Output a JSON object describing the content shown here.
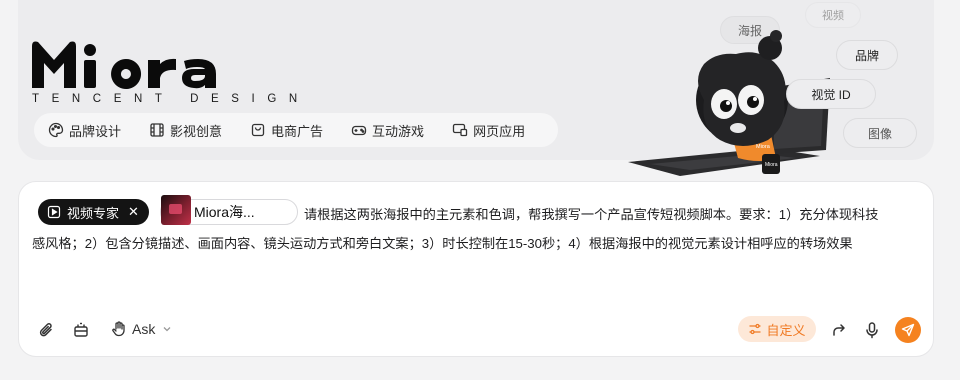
{
  "brand": {
    "name": "Miora",
    "subtitle": "TENCENT DESIGN"
  },
  "categories": [
    {
      "label": "品牌设计",
      "icon": "palette-icon"
    },
    {
      "label": "影视创意",
      "icon": "film-icon"
    },
    {
      "label": "电商广告",
      "icon": "shopping-bag-icon"
    },
    {
      "label": "互动游戏",
      "icon": "gamepad-icon"
    },
    {
      "label": "网页应用",
      "icon": "browser-window-icon"
    }
  ],
  "floating_tags": {
    "poster": "海报",
    "video": "视频",
    "brand": "品牌",
    "visual_id": "视觉 ID",
    "image": "图像"
  },
  "mascot": {
    "label": "Miora"
  },
  "composer": {
    "expert_tag": "视频专家",
    "expert_close": "✕",
    "attachment_name": "Miora海...",
    "prompt_line1": "请根据这两张海报中的主元素和色调，帮我撰写一个产品宣传短视频脚本。要求：1）充分体现科技",
    "prompt_line2": "感风格；2）包含分镜描述、画面内容、镜头运动方式和旁白文案；3）时长控制在15-30秒；4）根据海报中的视觉元素设计相呼应的转场效果",
    "mode_label": "Ask",
    "custom_label": "自定义"
  },
  "colors": {
    "accent": "#f5821f",
    "accent_soft": "#fde8d8",
    "dark": "#141414"
  }
}
